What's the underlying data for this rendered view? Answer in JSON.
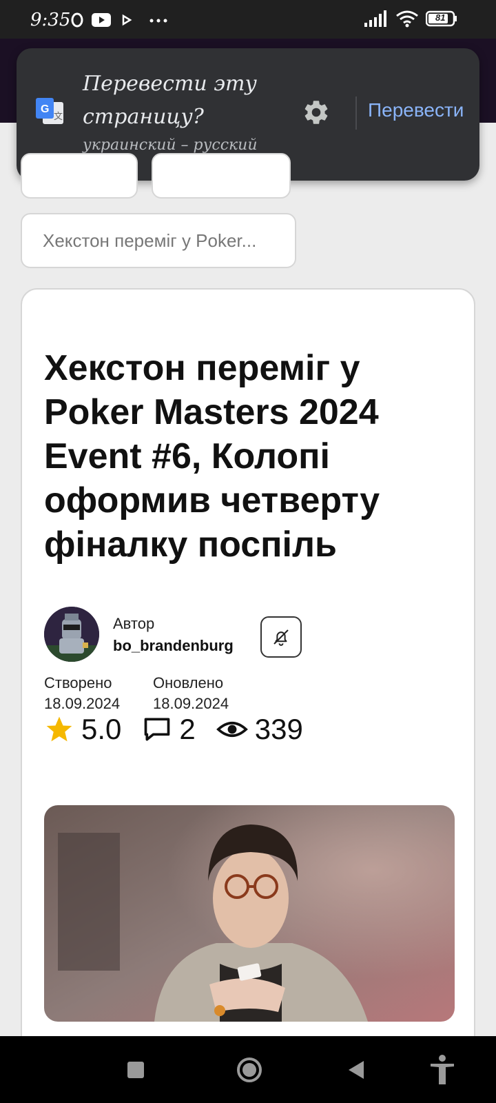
{
  "status_bar": {
    "time": "9:35",
    "battery": "81"
  },
  "translate_bar": {
    "title": "Перевести эту страницу?",
    "languages": "украинский – русский",
    "translate_button": "Перевести"
  },
  "breadcrumb": {
    "current": "Хекстон переміг у Poker..."
  },
  "article": {
    "title": "Хекстон переміг у Poker Masters 2024 Event #6, Колопі оформив четверту фіналку поспіль",
    "author_label": "Автор",
    "author_name": "bo_brandenburg",
    "created_label": "Створено",
    "created_date": "18.09.2024",
    "updated_label": "Оновлено",
    "updated_date": "18.09.2024",
    "rating": "5.0",
    "comments": "2",
    "views": "339"
  },
  "icons": {
    "translate": "google-translate-icon",
    "settings": "gear-icon",
    "bell": "bell-off-icon",
    "star": "star-icon",
    "comment": "comment-icon",
    "eye": "eye-icon"
  },
  "colors": {
    "translate_accent": "#8ab4f8",
    "star": "#f5b800",
    "popup_bg": "#303134"
  }
}
